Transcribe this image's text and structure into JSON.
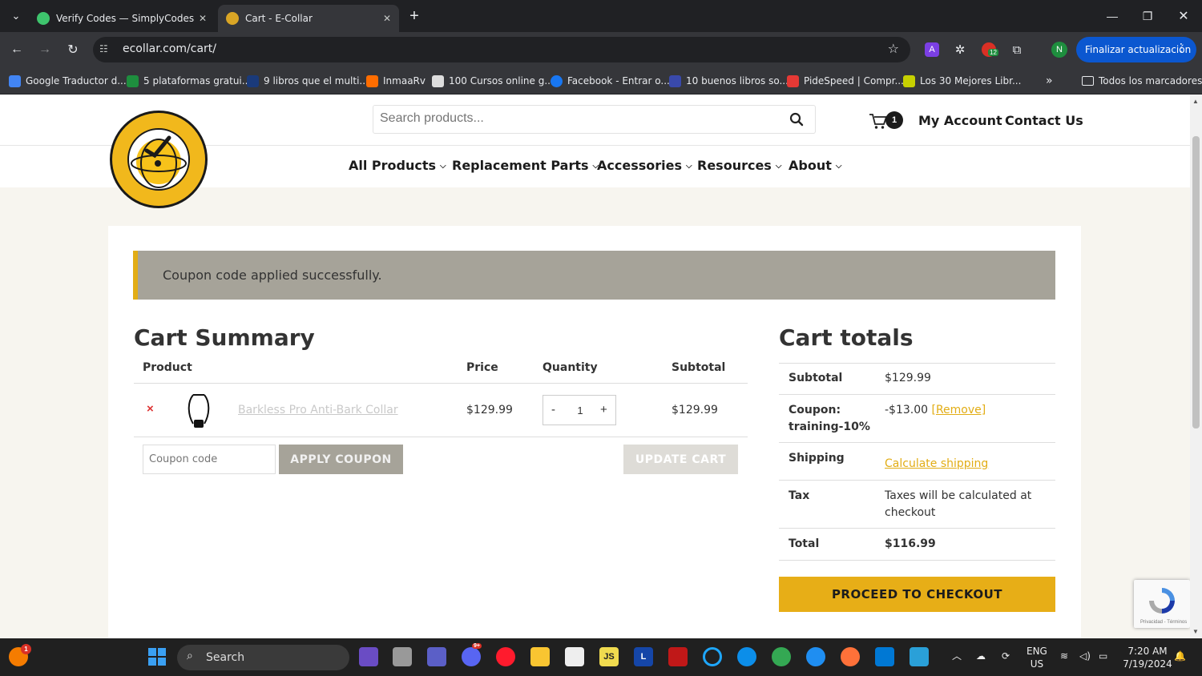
{
  "browser": {
    "tabs": [
      {
        "title": "Verify Codes — SimplyCodes",
        "icon": "simplycodes-favicon",
        "active": false
      },
      {
        "title": "Cart - E-Collar",
        "icon": "ecollar-favicon",
        "active": true
      }
    ],
    "url": "ecollar.com/cart/",
    "update_button": "Finalizar actualización",
    "profile_initial": "N",
    "extension_badge": "12",
    "bookmarks": [
      "Google Traductor d...",
      "5 plataformas gratui...",
      "9 libros que el multi...",
      "InmaaRv",
      "100 Cursos online g...",
      "Facebook - Entrar o...",
      "10 buenos libros so...",
      "PideSpeed | Compr...",
      "Los 30 Mejores Libr..."
    ],
    "all_bookmarks": "Todos los marcadores",
    "more_bookmarks": "»"
  },
  "site": {
    "search_placeholder": "Search products...",
    "cart_count": "1",
    "my_account": "My Account",
    "contact_us": "Contact Us",
    "menu": [
      "All Products",
      "Replacement Parts",
      "Accessories",
      "Resources",
      "About"
    ]
  },
  "notice": "Coupon code applied successfully.",
  "cart": {
    "title": "Cart Summary",
    "columns": {
      "product": "Product",
      "price": "Price",
      "quantity": "Quantity",
      "subtotal": "Subtotal"
    },
    "items": [
      {
        "remove": "×",
        "name": "Barkless Pro Anti-Bark Collar",
        "price": "$129.99",
        "qty": "1",
        "subtotal": "$129.99"
      }
    ],
    "qty_minus": "-",
    "qty_plus": "+",
    "coupon_placeholder": "Coupon code",
    "apply_coupon": "APPLY COUPON",
    "update_cart": "UPDATE CART"
  },
  "totals": {
    "title": "Cart totals",
    "subtotal_label": "Subtotal",
    "subtotal": "$129.99",
    "coupon_label_1": "Coupon:",
    "coupon_label_2": "training-10%",
    "coupon_value": "-$13.00",
    "coupon_remove": "[Remove]",
    "shipping_label": "Shipping",
    "shipping_link": "Calculate shipping",
    "tax_label": "Tax",
    "tax_line1": "Taxes will be calculated at",
    "tax_line2": "checkout",
    "total_label": "Total",
    "total": "$116.99",
    "checkout": "PROCEED TO CHECKOUT"
  },
  "recaptcha_text": "Privacidad - Términos",
  "taskbar": {
    "search": "Search",
    "lang_1": "ENG",
    "lang_2": "US",
    "time": "7:20 AM",
    "date": "7/19/2024",
    "start_badge": "1",
    "discord_badge": "9+"
  },
  "colors": {
    "accent": "#e7ae17",
    "notice_bg": "#a6a399",
    "chrome_dark": "#202124",
    "chrome_bar": "#35363a",
    "update_blue": "#0b57d0"
  }
}
